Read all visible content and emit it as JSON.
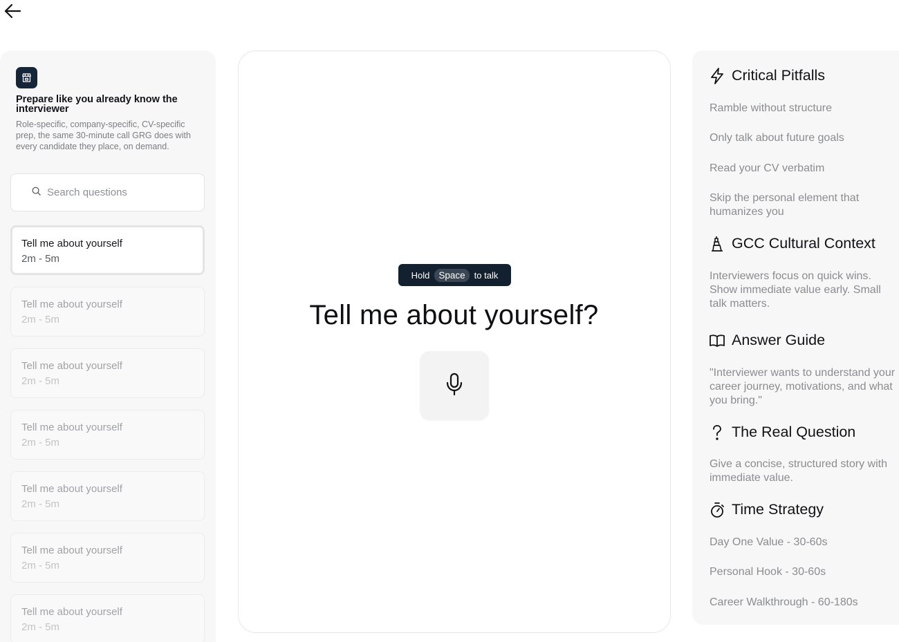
{
  "nav": {
    "back_icon": "arrow-left-icon"
  },
  "intro": {
    "icon": "store-icon",
    "title": "Prepare like you already know the interviewer",
    "description": "Role-specific, company-specific, CV-specific prep, the same 30-minute call GRG does with every candidate they place, on demand."
  },
  "search": {
    "placeholder": "Search questions",
    "value": ""
  },
  "questions": [
    {
      "title": "Tell me about yourself",
      "time": "2m - 5m",
      "active": true
    },
    {
      "title": "Tell me about yourself",
      "time": "2m - 5m",
      "active": false
    },
    {
      "title": "Tell me about yourself",
      "time": "2m - 5m",
      "active": false
    },
    {
      "title": "Tell me about yourself",
      "time": "2m - 5m",
      "active": false
    },
    {
      "title": "Tell me about yourself",
      "time": "2m - 5m",
      "active": false
    },
    {
      "title": "Tell me about yourself",
      "time": "2m - 5m",
      "active": false
    },
    {
      "title": "Tell me about yourself",
      "time": "2m - 5m",
      "active": false
    }
  ],
  "center": {
    "hint_prefix": "Hold",
    "hint_key": "Space",
    "hint_suffix": "to talk",
    "question": "Tell me about yourself?",
    "mic_icon": "microphone-icon"
  },
  "sidebar": {
    "pitfalls": {
      "icon": "lightning-icon",
      "title": "Critical Pitfalls",
      "items": [
        "Ramble without structure",
        "Only talk about future goals",
        "Read your CV verbatim",
        "Skip the personal element that humanizes you"
      ]
    },
    "culture": {
      "icon": "tower-icon",
      "title": "GCC Cultural Context",
      "text": "Interviewers focus on quick wins. Show immediate value early. Small talk matters."
    },
    "guide": {
      "icon": "book-open-icon",
      "title": "Answer Guide",
      "text": "\"Interviewer wants to understand your career journey, motivations, and what you bring.\""
    },
    "real_question": {
      "icon": "question-mark-icon",
      "title": "The Real Question",
      "text": "Give a concise, structured story with immediate value."
    },
    "time": {
      "icon": "stopwatch-icon",
      "title": "Time Strategy",
      "items": [
        "Day One Value - 30-60s",
        "Personal Hook - 30-60s",
        "Career Walkthrough - 60-180s"
      ]
    }
  }
}
